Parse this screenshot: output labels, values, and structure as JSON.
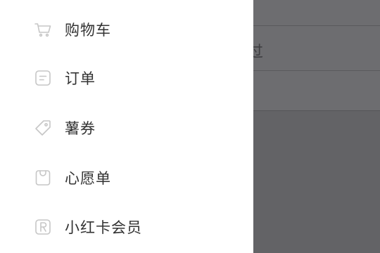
{
  "background_page": {
    "partial_text": "过"
  },
  "drawer": {
    "items": [
      {
        "label": "购物车",
        "icon": "cart-icon"
      },
      {
        "label": "订单",
        "icon": "order-icon"
      },
      {
        "label": "薯券",
        "icon": "coupon-tag-icon"
      },
      {
        "label": "心愿单",
        "icon": "wishlist-bag-icon"
      },
      {
        "label": "小红卡会员",
        "icon": "membership-r-icon"
      }
    ]
  },
  "colors": {
    "overlay": "#5e5e61",
    "drawer_bg": "#ffffff",
    "label_text": "#333333",
    "icon_stroke": "#c8c8c8"
  }
}
